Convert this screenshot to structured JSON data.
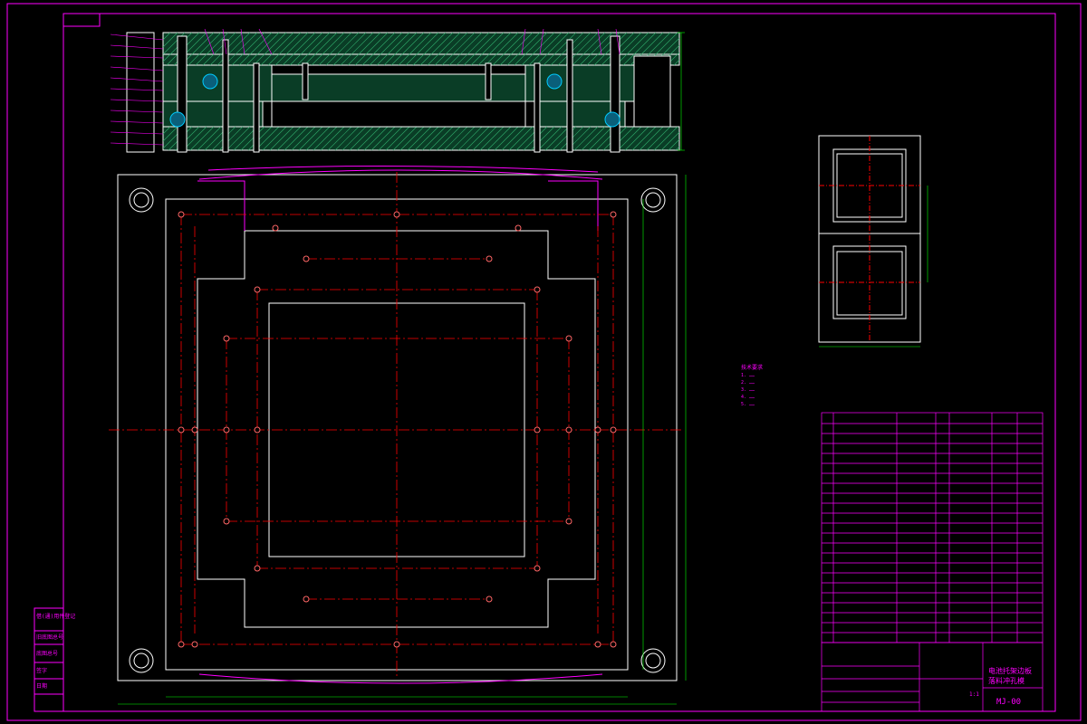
{
  "colors": {
    "background": "#000000",
    "frame": "#ff00ff",
    "outline": "#ffffff",
    "centerline": "#ff0000",
    "hatch": "#00aa55",
    "dimension": "#00ff00",
    "text_magenta": "#ff00ff",
    "note_text": "#ff00ff",
    "springs": "#00ccff"
  },
  "notes": {
    "title": "技术要求",
    "lines": [
      "1. ……",
      "2. ……",
      "3. ……",
      "4. ……",
      "5. ……"
    ]
  },
  "title_block": {
    "scale_text": "1:1",
    "weight_text": "1:1",
    "drawing_no": "MJ-00",
    "name_line1": "电池托架边板",
    "name_line2": "落料冲孔模"
  },
  "side_labels": [
    "旧底图总号",
    "底图总号",
    "签字",
    "日期",
    "借(通)用件登记"
  ]
}
